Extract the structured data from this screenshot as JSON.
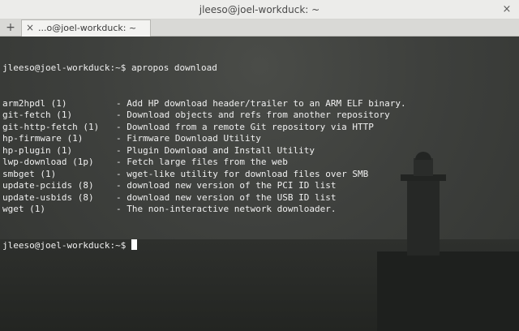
{
  "window": {
    "title": "jleeso@joel-workduck: ~",
    "close_glyph": "×"
  },
  "tabs": [
    {
      "label": "...o@joel-workduck: ~",
      "close_glyph": "×"
    }
  ],
  "new_tab_glyph": "+",
  "terminal": {
    "prompt": "jleeso@joel-workduck:~$",
    "command": "apropos download",
    "results": [
      {
        "name": "arm2hpdl (1)",
        "desc": "Add HP download header/trailer to an ARM ELF binary."
      },
      {
        "name": "git-fetch (1)",
        "desc": "Download objects and refs from another repository"
      },
      {
        "name": "git-http-fetch (1)",
        "desc": "Download from a remote Git repository via HTTP"
      },
      {
        "name": "hp-firmware (1)",
        "desc": "Firmware Download Utility"
      },
      {
        "name": "hp-plugin (1)",
        "desc": "Plugin Download and Install Utility"
      },
      {
        "name": "lwp-download (1p)",
        "desc": "Fetch large files from the web"
      },
      {
        "name": "smbget (1)",
        "desc": "wget-like utility for download files over SMB"
      },
      {
        "name": "update-pciids (8)",
        "desc": "download new version of the PCI ID list"
      },
      {
        "name": "update-usbids (8)",
        "desc": "download new version of the USB ID list"
      },
      {
        "name": "wget (1)",
        "desc": "The non-interactive network downloader."
      }
    ],
    "final_prompt": "jleeso@joel-workduck:~$"
  }
}
